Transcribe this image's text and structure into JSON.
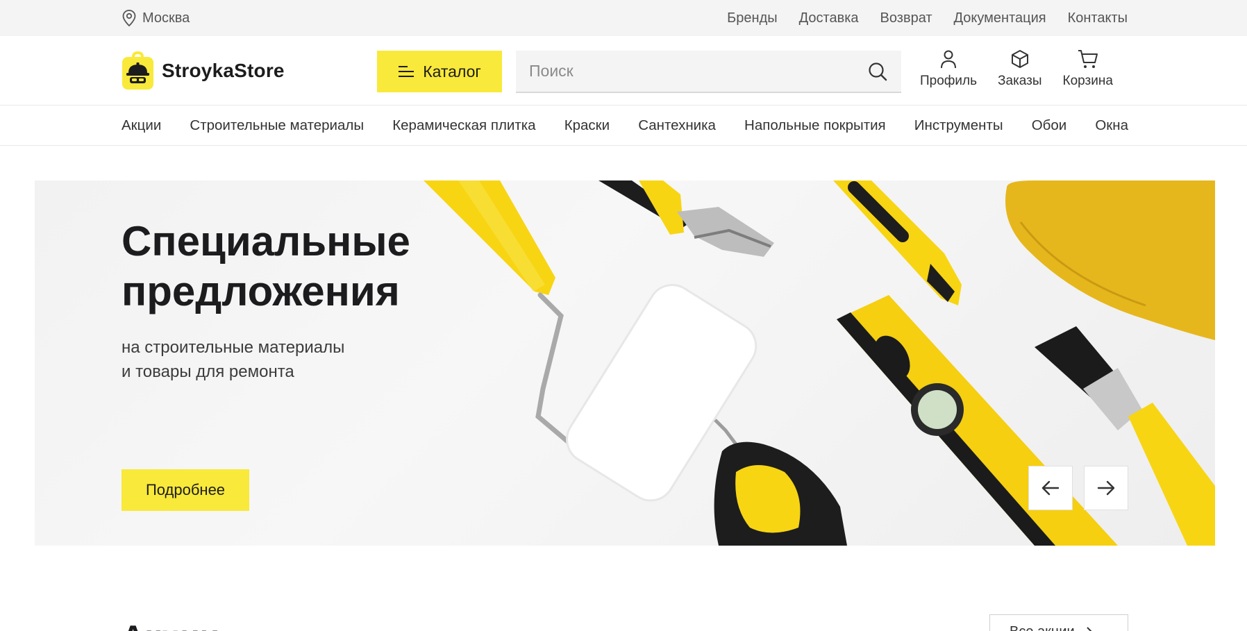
{
  "topbar": {
    "city": "Москва",
    "links": [
      "Бренды",
      "Доставка",
      "Возврат",
      "Документация",
      "Контакты"
    ]
  },
  "header": {
    "logo_text": "StroykaStore",
    "catalog_label": "Каталог",
    "search_placeholder": "Поиск",
    "icons": {
      "profile": "Профиль",
      "orders": "Заказы",
      "cart": "Корзина"
    }
  },
  "nav": {
    "items": [
      "Акции",
      "Строительные материалы",
      "Керамическая плитка",
      "Краски",
      "Сантехника",
      "Напольные покрытия",
      "Инструменты",
      "Обои",
      "Окна"
    ]
  },
  "hero": {
    "title_line1": "Специальные",
    "title_line2": "предложения",
    "subtitle_line1": "на строительные материалы",
    "subtitle_line2": "и товары для ремонта",
    "button_label": "Подробнее"
  },
  "section": {
    "title": "Акции",
    "all_label": "Все акции"
  },
  "colors": {
    "accent": "#f9e93a",
    "text": "#1c1c1e",
    "topbar_bg": "#f4f4f4"
  },
  "icons": [
    "location-pin-icon",
    "catalog-menu-icon",
    "search-icon",
    "user-icon",
    "box-icon",
    "cart-icon",
    "arrow-left-icon",
    "arrow-right-icon"
  ]
}
